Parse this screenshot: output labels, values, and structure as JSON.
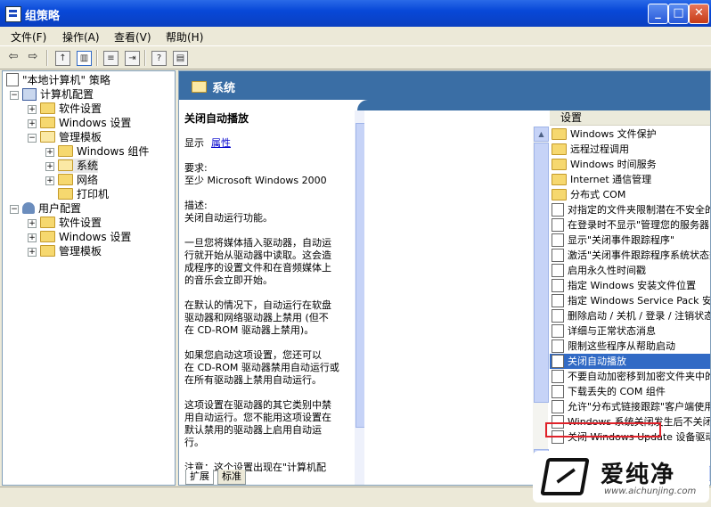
{
  "window": {
    "title": "组策略",
    "minimize_glyph": "_",
    "maximize_glyph": "□",
    "close_glyph": "✕"
  },
  "menu": [
    "文件(F)",
    "操作(A)",
    "查看(V)",
    "帮助(H)"
  ],
  "toolbar": {
    "back_icon": "back-arrow-icon",
    "forward_icon": "forward-arrow-icon",
    "up_icon": "up-folder-icon",
    "console_icon": "show-hide-tree-icon",
    "properties_icon": "properties-icon",
    "export_icon": "export-list-icon",
    "help_icon": "help-icon",
    "view_icon": "extended-view-icon"
  },
  "tree": {
    "root": "\"本地计算机\" 策略",
    "computer_config": "计算机配置",
    "software_settings": "软件设置",
    "windows_settings": "Windows 设置",
    "admin_templates": "管理模板",
    "windows_components": "Windows 组件",
    "system": "系统",
    "network": "网络",
    "printers": "打印机",
    "user_config": "用户配置",
    "user_software_settings": "软件设置",
    "user_windows_settings": "Windows 设置",
    "user_admin_templates": "管理模板"
  },
  "header": {
    "title": "系统"
  },
  "extended": {
    "policy_title": "关闭自动播放",
    "display_label": "显示",
    "properties_link": "属性",
    "requires_label": "要求:",
    "requires_value": "至少 Microsoft Windows 2000",
    "desc_label": "描述:",
    "desc_line": "关闭自动运行功能。",
    "para1": [
      "一旦您将媒体插入驱动器，自动运",
      "行就开始从驱动器中读取。这会造",
      "成程序的设置文件和在音频媒体上",
      "的音乐会立即开始。"
    ],
    "para2": [
      "在默认的情况下，自动运行在软盘",
      "驱动器和网络驱动器上禁用 (但不",
      "在 CD-ROM 驱动器上禁用)。"
    ],
    "para3": [
      "如果您启动这项设置，您还可以",
      "在 CD-ROM 驱动器禁用自动运行或",
      "在所有驱动器上禁用自动运行。"
    ],
    "para4": [
      "这项设置在驱动器的其它类别中禁",
      "用自动运行。您不能用这项设置在",
      "默认禁用的驱动器上启用自动运",
      "行。"
    ],
    "note": "注意：这个设置出现在\"计算机配"
  },
  "list": {
    "column": "设置",
    "items": [
      {
        "label": "Windows 文件保护",
        "kind": "folder"
      },
      {
        "label": "远程过程调用",
        "kind": "folder"
      },
      {
        "label": "Windows 时间服务",
        "kind": "folder"
      },
      {
        "label": "Internet 通信管理",
        "kind": "folder"
      },
      {
        "label": "分布式 COM",
        "kind": "folder"
      },
      {
        "label": "对指定的文件夹限制潜在不安全的\"HTML 帮助\"功能",
        "kind": "policy"
      },
      {
        "label": "在登录时不显示\"管理您的服务器\"页",
        "kind": "policy"
      },
      {
        "label": "显示\"关闭事件跟踪程序\"",
        "kind": "policy"
      },
      {
        "label": "激活\"关闭事件跟踪程序系统状态数据\"功能",
        "kind": "policy"
      },
      {
        "label": "启用永久性时间戳",
        "kind": "policy"
      },
      {
        "label": "指定 Windows 安装文件位置",
        "kind": "policy"
      },
      {
        "label": "指定 Windows Service Pack 安装文件位置",
        "kind": "policy"
      },
      {
        "label": "删除启动 / 关机 / 登录 / 注销状态消息",
        "kind": "policy"
      },
      {
        "label": "详细与正常状态消息",
        "kind": "policy"
      },
      {
        "label": "限制这些程序从帮助启动",
        "kind": "policy"
      },
      {
        "label": "关闭自动播放",
        "kind": "policy",
        "selected": true
      },
      {
        "label": "不要自动加密移到加密文件夹中的文件",
        "kind": "policy"
      },
      {
        "label": "下载丢失的 COM 组件",
        "kind": "policy"
      },
      {
        "label": "允许\"分布式链接跟踪\"客户端使用域资源",
        "kind": "policy"
      },
      {
        "label": "Windows 系统关闭发生后不关闭系统电源.",
        "kind": "policy"
      },
      {
        "label": "关闭 Windows Update 设备驱动程序搜索提示",
        "kind": "policy"
      }
    ]
  },
  "tabs": {
    "extended": "扩展",
    "standard": "标准"
  },
  "watermark": {
    "name": "爱纯净",
    "url": "www.aichunjing.com"
  },
  "colors": {
    "selection": "#316ac5",
    "header": "#3a6ea5",
    "highlight_box": "#e0222a"
  }
}
